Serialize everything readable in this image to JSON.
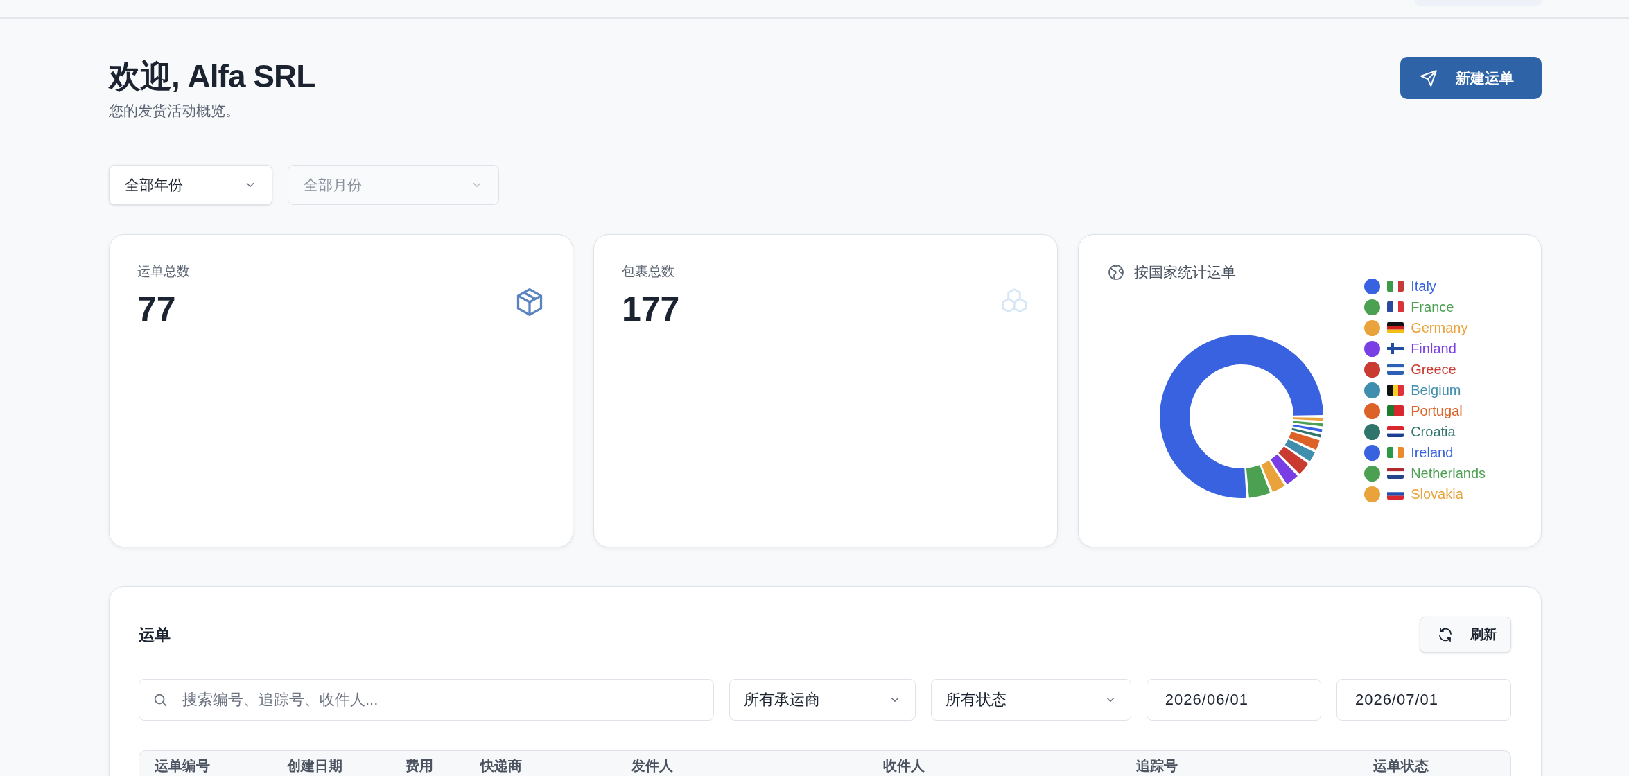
{
  "header": {
    "title": "欢迎, Alfa SRL",
    "subtitle": "您的发货活动概览。",
    "new_button": "新建运单"
  },
  "filters": [
    {
      "label": "全部年份",
      "disabled": false
    },
    {
      "label": "全部月份",
      "disabled": true
    }
  ],
  "stats": [
    {
      "label": "运单总数",
      "value": "77",
      "kind": "shipments"
    },
    {
      "label": "包裹总数",
      "value": "177",
      "kind": "parcels"
    }
  ],
  "country_chart": {
    "title": "按国家统计运单",
    "legend": [
      {
        "name": "Italy",
        "color": "#3862e0"
      },
      {
        "name": "France",
        "color": "#4ba052"
      },
      {
        "name": "Germany",
        "color": "#eaa23a"
      },
      {
        "name": "Finland",
        "color": "#7a3fe4"
      },
      {
        "name": "Greece",
        "color": "#c93a31"
      },
      {
        "name": "Belgium",
        "color": "#3f8eae"
      },
      {
        "name": "Portugal",
        "color": "#dc6228"
      },
      {
        "name": "Croatia",
        "color": "#30756c"
      },
      {
        "name": "Ireland",
        "color": "#3862e0"
      },
      {
        "name": "Netherlands",
        "color": "#4ba052"
      },
      {
        "name": "Slovakia",
        "color": "#eaa23a"
      }
    ]
  },
  "shipments": {
    "title": "运单",
    "refresh_button": "刷新",
    "search": {
      "placeholder": "搜索编号、追踪号、收件人..."
    },
    "carrier_filter": "所有承运商",
    "status_filter": "所有状态",
    "date_from": "2026/06/01",
    "date_to": "2026/07/01",
    "table": {
      "columns": [
        "运单编号",
        "创建日期",
        "费用",
        "快递商",
        "发件人",
        "收件人",
        "追踪号",
        "运单状态"
      ]
    }
  }
}
